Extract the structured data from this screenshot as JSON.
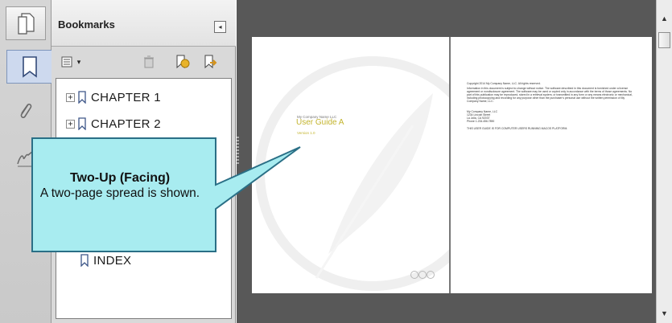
{
  "panel": {
    "title": "Bookmarks",
    "collapse_glyph": "◂",
    "options_glyph": "▾"
  },
  "bookmarks": [
    {
      "label": "CHAPTER 1",
      "expandable": true
    },
    {
      "label": "CHAPTER 2",
      "expandable": true
    },
    {
      "label": "INDEX",
      "expandable": false
    }
  ],
  "expander_glyph": "+",
  "callout": {
    "title": "Two-Up (Facing)",
    "body": "A two-page spread is shown."
  },
  "cover_page": {
    "company": "My Company Name LLC",
    "title": "User Guide A",
    "version": "Version 1.0"
  },
  "copyright_page": {
    "line1": "Copyright 2014 My Company Name, LLC. All rights reserved.",
    "paragraph": "Information in this document is subject to change without notice. The software described in this document is furnished under a license agreement or nondisclosure agreement. The software may be used or copied only in accordance with the terms of those agreements. No part of this publication may be reproduced, stored in a retrieval system, or transmitted in any form or any means electronic or mechanical, including photocopying and recording for any purpose other than the purchaser's personal use without the written permission of My Company Name, LLC.",
    "address1": "My Company Name, LLC",
    "address2": "1234 Lincoln Street",
    "address3": "La Jolla, CA 92037",
    "address4": "Phone 1.234.456.7890",
    "footer": "THIS USER GUIDE IS FOR COMPUTER USERS RUNNING MACOS PLATFORM."
  },
  "icons": {
    "pages": "pages-icon",
    "bookmark": "bookmark-icon",
    "attachment": "paperclip-icon",
    "signature": "signature-icon"
  },
  "colors": {
    "callout_fill": "#a8ecf0",
    "callout_border": "#2a6f86",
    "cover_accent": "#c3b42d",
    "doc_background": "#585858"
  }
}
